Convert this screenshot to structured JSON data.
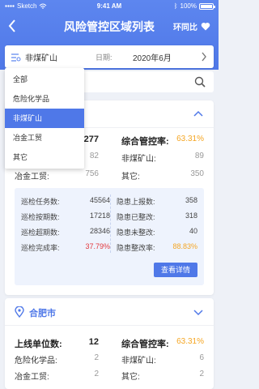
{
  "status_bar": {
    "carrier": "Sketch",
    "time": "9:41 AM",
    "battery": "100%"
  },
  "nav": {
    "title": "风险管控区域列表",
    "right_label": "环同比"
  },
  "filter": {
    "selected": "非煤矿山",
    "date_label": "日期:",
    "date_value": "2020年6月"
  },
  "dropdown": {
    "options": [
      "全部",
      "危险化学品",
      "非煤矿山",
      "冶金工贸",
      "其它"
    ],
    "active_index": 2
  },
  "card1": {
    "rows": [
      {
        "k": "",
        "v": "277",
        "k2": "综合管控率:",
        "v2": "63.31%"
      },
      {
        "k": "",
        "v": "82",
        "k2": "非煤矿山:",
        "v2": "89"
      },
      {
        "k": "冶金工贸:",
        "v": "756",
        "k2": "其它:",
        "v2": "350"
      }
    ],
    "stats": [
      {
        "a": "巡检任务数:",
        "av": "45564",
        "b": "隐患上报数:",
        "bv": "358"
      },
      {
        "a": "巡检按期数:",
        "av": "17218",
        "b": "隐患已整改:",
        "bv": "318"
      },
      {
        "a": "巡检超期数:",
        "av": "28346",
        "b": "隐患未整改:",
        "bv": "40"
      },
      {
        "a": "巡检完成率:",
        "av": "37.79%",
        "b": "隐患整改率:",
        "bv": "88.83%"
      }
    ],
    "detail_button": "查看详情"
  },
  "card2": {
    "city": "合肥市",
    "rows": [
      {
        "k": "上线单位数:",
        "v": "12",
        "k2": "综合管控率:",
        "v2": "63.31%"
      },
      {
        "k": "危险化学品:",
        "v": "2",
        "k2": "非煤矿山:",
        "v2": "6"
      },
      {
        "k": "冶金工贸:",
        "v": "2",
        "k2": "其它:",
        "v2": "2"
      }
    ]
  },
  "colors": {
    "primary": "#4f78e8",
    "orange": "#f5a623",
    "red": "#e2383d"
  }
}
